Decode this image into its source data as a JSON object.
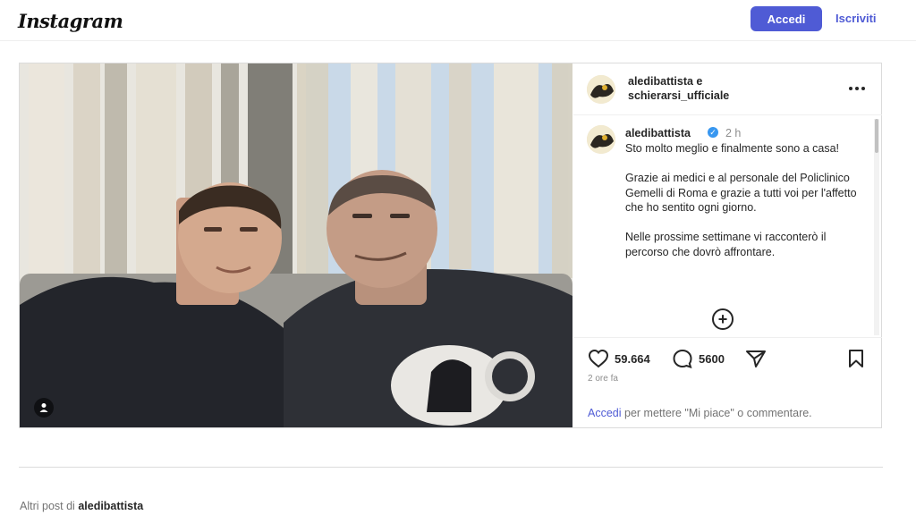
{
  "header": {
    "logo": "Instagram",
    "login_label": "Accedi",
    "signup_label": "Iscriviti"
  },
  "post": {
    "header_names": "aledibattista e schierarsi_ufficiale",
    "caption": {
      "username": "aledibattista",
      "time": "2 h",
      "paragraphs": [
        "Sto molto meglio e finalmente sono a casa!",
        "Grazie ai medici e al personale del Policlinico Gemelli di Roma e grazie a tutti voi per l'affetto che ho sentito ogni giorno.",
        "Nelle prossime settimane vi racconterò il percorso che dovrò affrontare."
      ]
    },
    "likes": "59.664",
    "comments": "5600",
    "time_ago": "2 ore fa",
    "login_link": "Accedi",
    "login_prompt": " per mettere \"Mi piace\" o commentare."
  },
  "more_posts": {
    "prefix": "Altri post di ",
    "username": "aledibattista"
  },
  "colors": {
    "accent": "#4f5bd5",
    "verified": "#3897f0"
  }
}
